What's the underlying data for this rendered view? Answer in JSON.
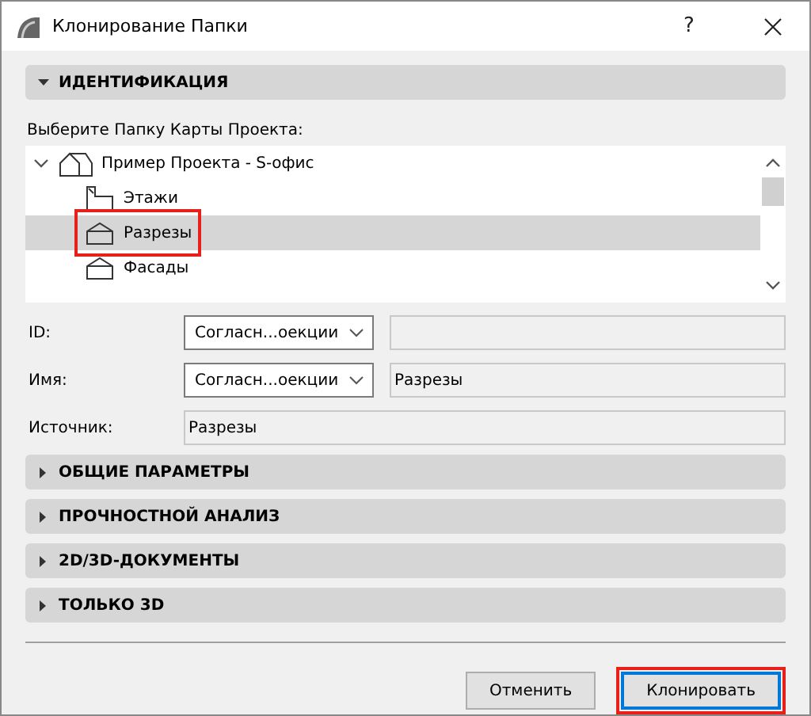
{
  "window": {
    "title": "Клонирование Папки",
    "help": "?"
  },
  "sections": [
    {
      "label": "ИДЕНТИФИКАЦИЯ",
      "expanded": true,
      "prompt": "Выберите Папку Карты Проекта:",
      "tree": [
        {
          "label": "Пример Проекта - S-офис",
          "kind": "project",
          "expanded": true,
          "selected": false,
          "children": [
            {
              "label": "Этажи",
              "kind": "stories",
              "selected": false,
              "highlighted": false
            },
            {
              "label": "Разрезы",
              "kind": "section",
              "selected": true,
              "highlighted": true
            },
            {
              "label": "Фасады",
              "kind": "section",
              "selected": false,
              "highlighted": false
            }
          ]
        }
      ],
      "fields": [
        {
          "label": "ID:",
          "kind": "combo",
          "dropdown": "Согласн...оекции"
        },
        {
          "label": "Имя:",
          "kind": "combo",
          "dropdown": "Согласн...оекции",
          "value": "Разрезы"
        },
        {
          "label": "Источник:",
          "kind": "text",
          "value": "Разрезы"
        }
      ]
    },
    {
      "label": "ОБЩИЕ ПАРАМЕТРЫ",
      "expanded": false
    },
    {
      "label": "ПРОЧНОСТНОЙ АНАЛИЗ",
      "expanded": false
    },
    {
      "label": "2D/3D-ДОКУМЕНТЫ",
      "expanded": false
    },
    {
      "label": "ТОЛЬКО 3D",
      "expanded": false
    }
  ],
  "buttons": [
    {
      "label": "Отменить",
      "default": false,
      "highlighted": false
    },
    {
      "label": "Клонировать",
      "default": true,
      "highlighted": true
    }
  ]
}
